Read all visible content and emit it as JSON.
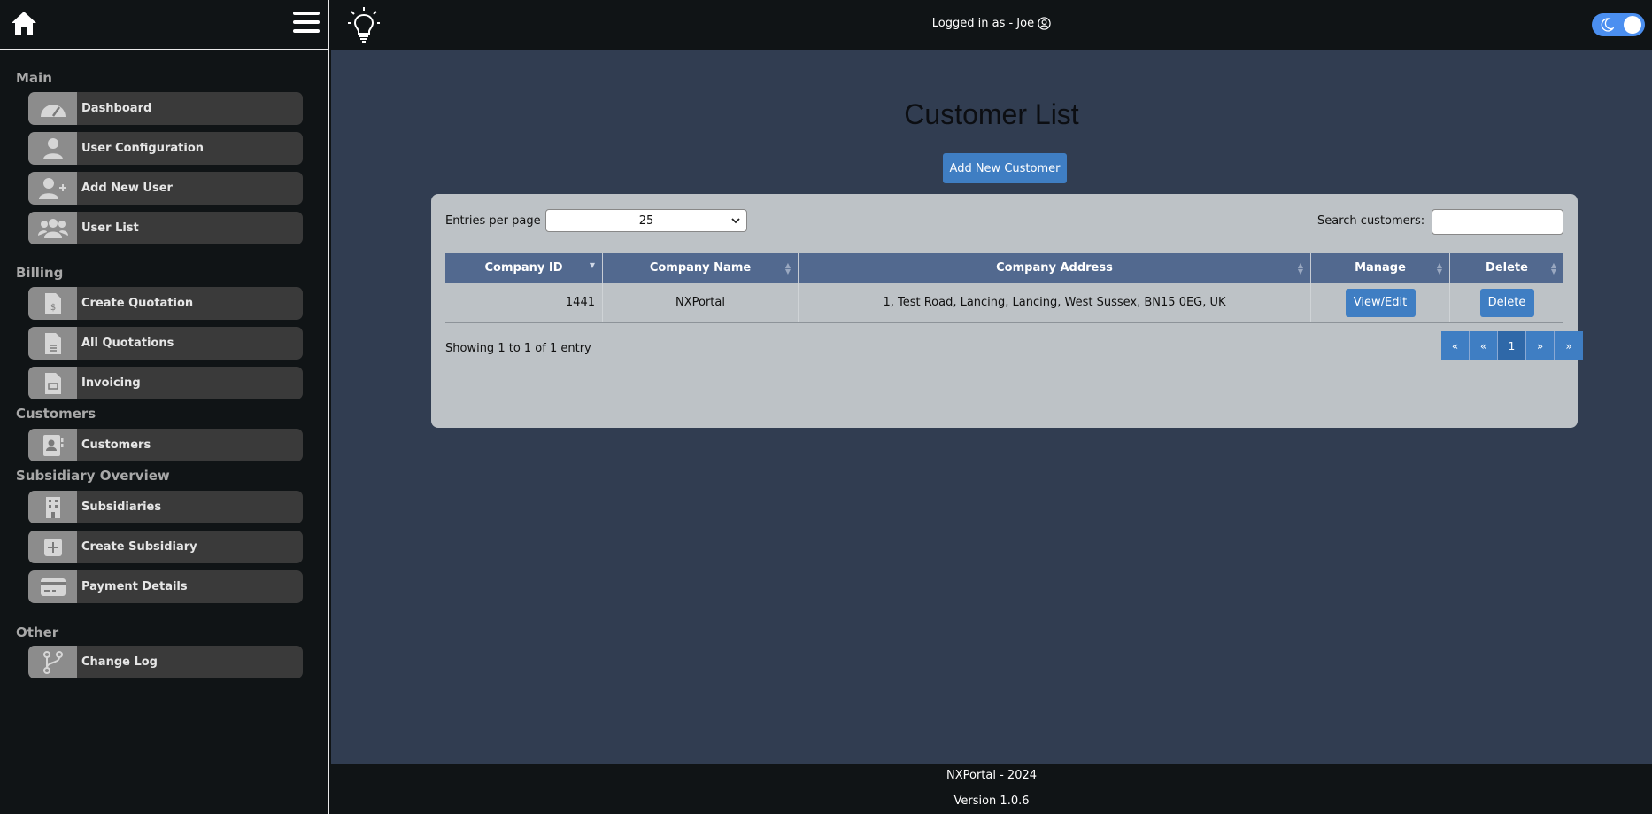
{
  "sidebar": {
    "sections": {
      "main": "Main",
      "billing": "Billing",
      "customers": "Customers",
      "subsidiary": "Subsidiary Overview",
      "other": "Other"
    },
    "items": {
      "dashboard": "Dashboard",
      "user_configuration": "User Configuration",
      "add_new_user": "Add New User",
      "user_list": "User List",
      "create_quotation": "Create Quotation",
      "all_quotations": "All Quotations",
      "invoicing": "Invoicing",
      "customers": "Customers",
      "subsidiaries": "Subsidiaries",
      "create_subsidiary": "Create Subsidiary",
      "payment_details": "Payment Details",
      "change_log": "Change Log"
    }
  },
  "header": {
    "logged_in": "Logged in as - Joe"
  },
  "main": {
    "title": "Customer List",
    "add_button": "Add New Customer",
    "entries_label": "Entries per page",
    "entries_value": "25",
    "search_label": "Search customers:",
    "search_value": ""
  },
  "table": {
    "columns": [
      "Company ID",
      "Company Name",
      "Company Address",
      "Manage",
      "Delete"
    ],
    "rows": [
      {
        "company_id": "1441",
        "company_name": "NXPortal",
        "company_address": "1, Test Road, Lancing, Lancing, West Sussex, BN15 0EG, UK",
        "manage_label": "View/Edit",
        "delete_label": "Delete"
      }
    ]
  },
  "pagination": {
    "showing": "Showing 1 to 1 of 1 entry",
    "first": "«",
    "prev": "«",
    "current": "1",
    "next": "»",
    "last": "»"
  },
  "footer": {
    "line1": "NXPortal - 2024",
    "line2": "Version 1.0.6"
  },
  "colors": {
    "accent": "#3f7ec3",
    "table_header": "#52698f",
    "main_bg": "#313d51",
    "panel_bg": "#bdc2c6",
    "toggle": "#4b8ff0"
  }
}
